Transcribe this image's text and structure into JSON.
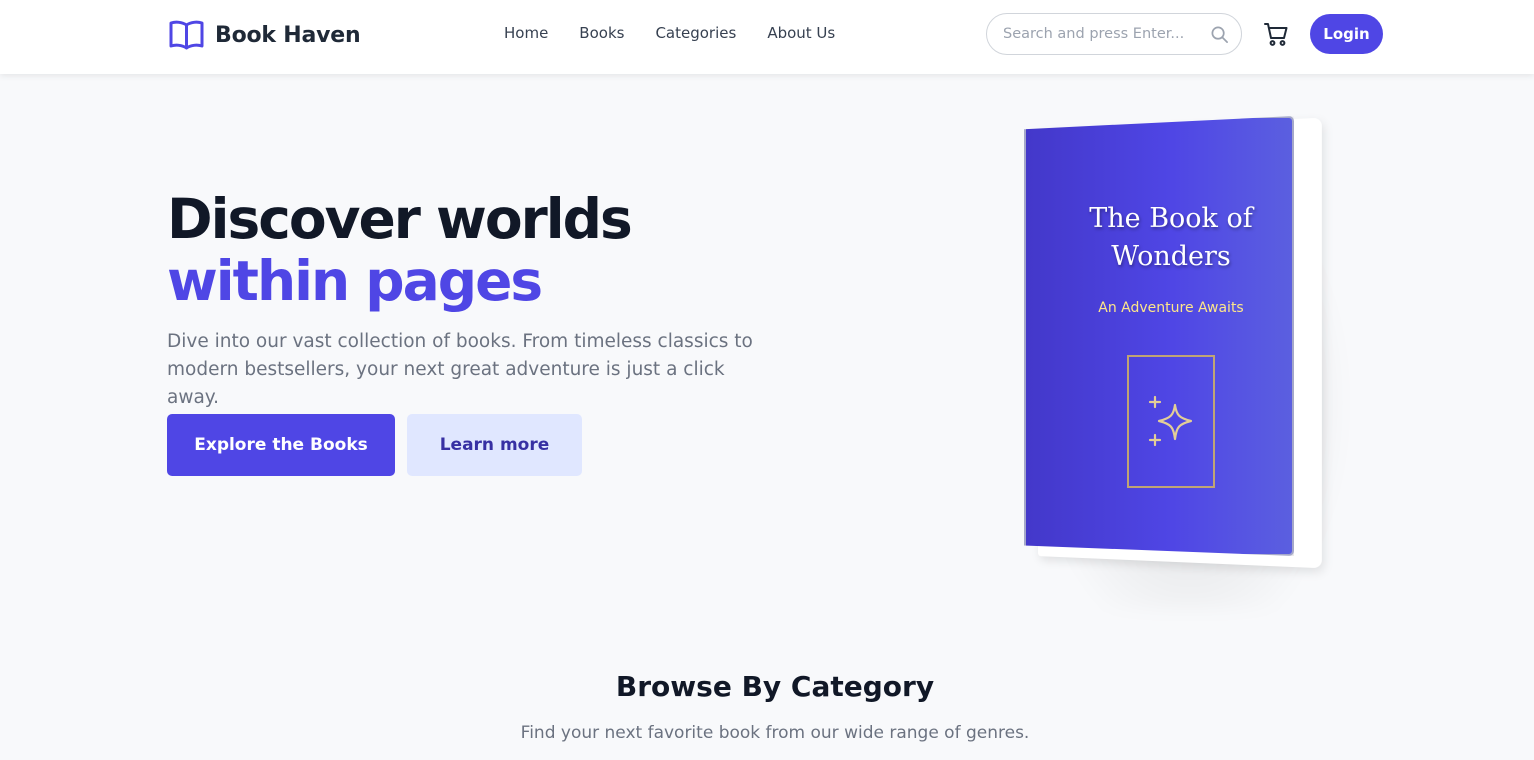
{
  "navbar": {
    "brand_name": "Book Haven",
    "brand_icon": "open-book-icon",
    "links": [
      "Home",
      "Books",
      "Categories",
      "About Us"
    ],
    "search_placeholder": "Search and press Enter...",
    "search_icon": "search-icon",
    "cart_icon": "shopping-cart-icon",
    "login_label": "Login"
  },
  "hero": {
    "title_line1": "Discover worlds",
    "title_line2": "within pages",
    "description": "Dive into our vast collection of books. From timeless classics to modern bestsellers, your next great adventure is just a click away.",
    "primary_button": "Explore the Books",
    "secondary_button": "Learn more"
  },
  "book": {
    "title": "The Book of Wonders",
    "subtitle": "An Adventure Awaits",
    "emblem_icon": "sparkles-icon"
  },
  "categories": {
    "title": "Browse By Category",
    "subtitle": "Find your next favorite book from our wide range of genres."
  },
  "colors": {
    "accent": "#4f46e5",
    "accent_light": "#e0e7ff",
    "heading": "#111827",
    "muted": "#6b7280",
    "book_gold": "#fde68a"
  }
}
